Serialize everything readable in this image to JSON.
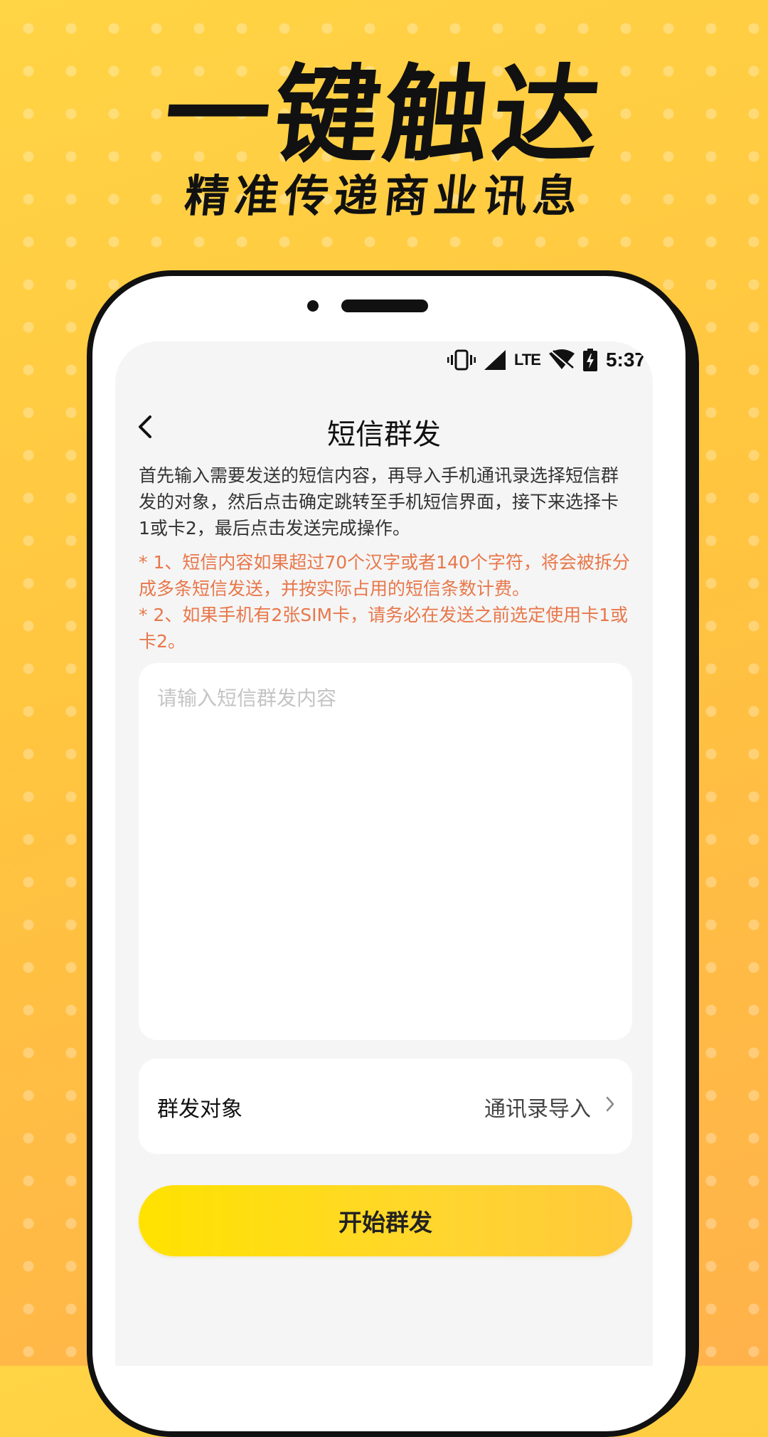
{
  "promo": {
    "headline": "一键触达",
    "subhead": "精准传递商业讯息"
  },
  "status_bar": {
    "time": "5:37",
    "network": "LTE",
    "icons": [
      "vibrate-icon",
      "signal-icon",
      "wifi-off-icon",
      "battery-charging-icon"
    ]
  },
  "navbar": {
    "title": "短信群发",
    "back_icon": "chevron-left-icon"
  },
  "instructions": {
    "description": "首先输入需要发送的短信内容，再导入手机通讯录选择短信群发的对象，然后点击确定跳转至手机短信界面，接下来选择卡1或卡2，最后点击发送完成操作。",
    "note_1": "* 1、短信内容如果超过70个汉字或者140个字符，将会被拆分成多条短信发送，并按实际占用的短信条数计费。",
    "note_2": "* 2、如果手机有2张SIM卡，请务必在发送之前选定使用卡1或卡2。"
  },
  "message_input": {
    "placeholder": "请输入短信群发内容",
    "value": ""
  },
  "recipients": {
    "label": "群发对象",
    "action": "通讯录导入"
  },
  "start_button": {
    "label": "开始群发"
  },
  "colors": {
    "background": "#ffc53f",
    "note_text": "#e8774a",
    "button_start": "#ffe200",
    "button_end": "#ffc93c"
  }
}
